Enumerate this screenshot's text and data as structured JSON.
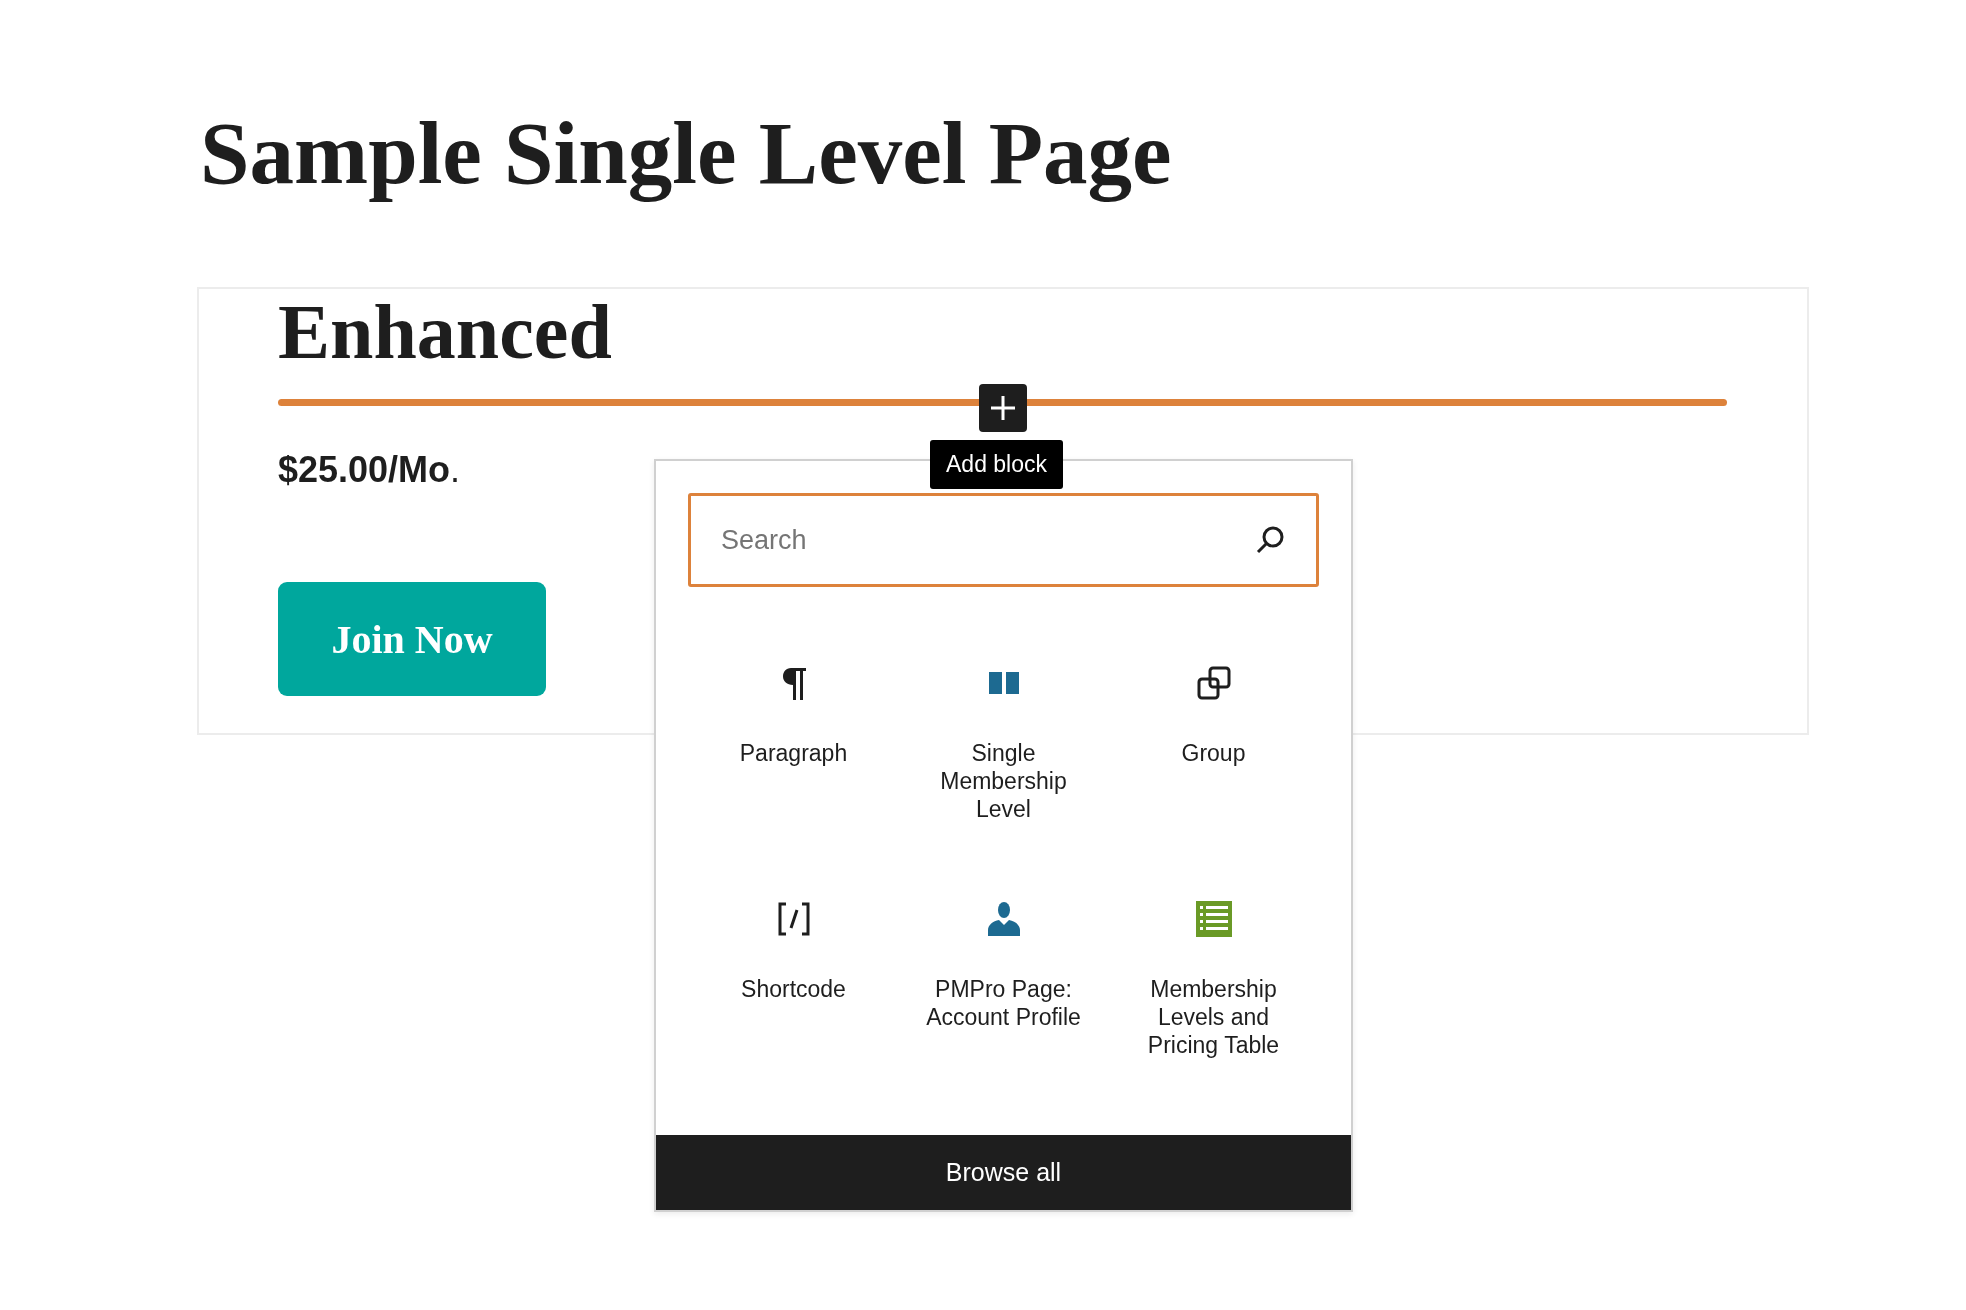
{
  "page_title": "Sample Single Level Page",
  "level_card": {
    "heading": "Enhanced",
    "price": "**$25.00/Mo**.",
    "button": "Join Now"
  },
  "inserter": {
    "add_button_tooltip": "Add block",
    "search": {
      "placeholder": "Search"
    },
    "blocks": [
      {
        "label": "Paragraph",
        "kind": "paragraph"
      },
      {
        "label": "Single Membership Level",
        "kind": "columns"
      },
      {
        "label": "Group",
        "kind": "group"
      },
      {
        "label": "Shortcode",
        "kind": "shortcode"
      },
      {
        "label": "PMPro Page: Account Profile",
        "kind": "person"
      },
      {
        "label": "Membership Levels and Pricing Table",
        "kind": "table"
      }
    ],
    "browse_all": "Browse all"
  }
}
